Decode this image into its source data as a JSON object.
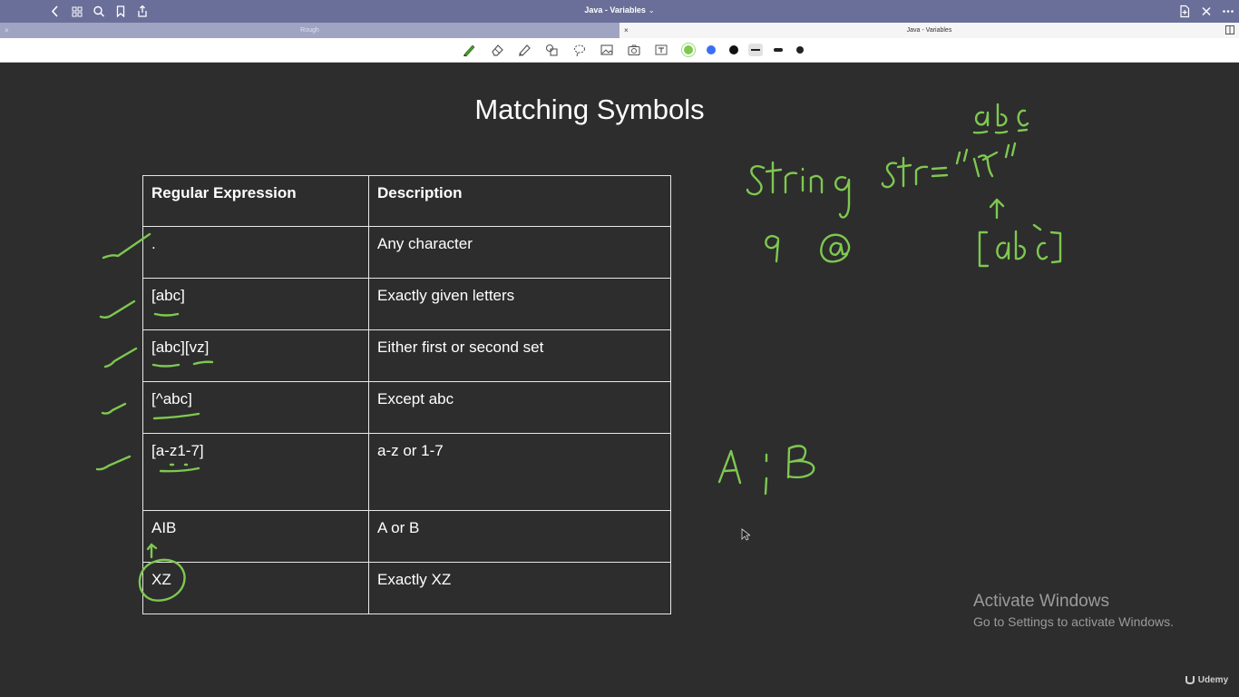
{
  "app": {
    "title": "Java - Variables",
    "title_caret": "⌄"
  },
  "tabs": [
    {
      "label": "Rough",
      "close": "×",
      "active": false
    },
    {
      "label": "Java - Variables",
      "close": "×",
      "active": true
    }
  ],
  "toolbar": {
    "tools": [
      "pen-icon",
      "eraser-icon",
      "highlighter-icon",
      "shapes-icon",
      "lasso-icon",
      "image-icon",
      "camera-icon",
      "text-icon"
    ],
    "colors": [
      "#7ec850",
      "#3b6ef5",
      "#111111"
    ],
    "selected_color": "#7ec850"
  },
  "slide": {
    "title": "Matching Symbols",
    "table": {
      "headers": [
        "Regular Expression",
        "Description"
      ],
      "rows": [
        {
          "expr": ".",
          "desc": "Any character"
        },
        {
          "expr": "[abc]",
          "desc": "Exactly given letters"
        },
        {
          "expr": "[abc][vz]",
          "desc": "Either first or second set"
        },
        {
          "expr": "[^abc]",
          "desc": "Except abc"
        },
        {
          "expr": "[a-z1-7]",
          "desc": "a-z or 1-7"
        },
        {
          "expr": "AIB",
          "desc": "A or B"
        },
        {
          "expr": "XZ",
          "desc": "Exactly XZ"
        }
      ]
    }
  },
  "watermark": {
    "line1": "Activate Windows",
    "line2": "Go to Settings to activate Windows."
  },
  "brand": "Udemy"
}
